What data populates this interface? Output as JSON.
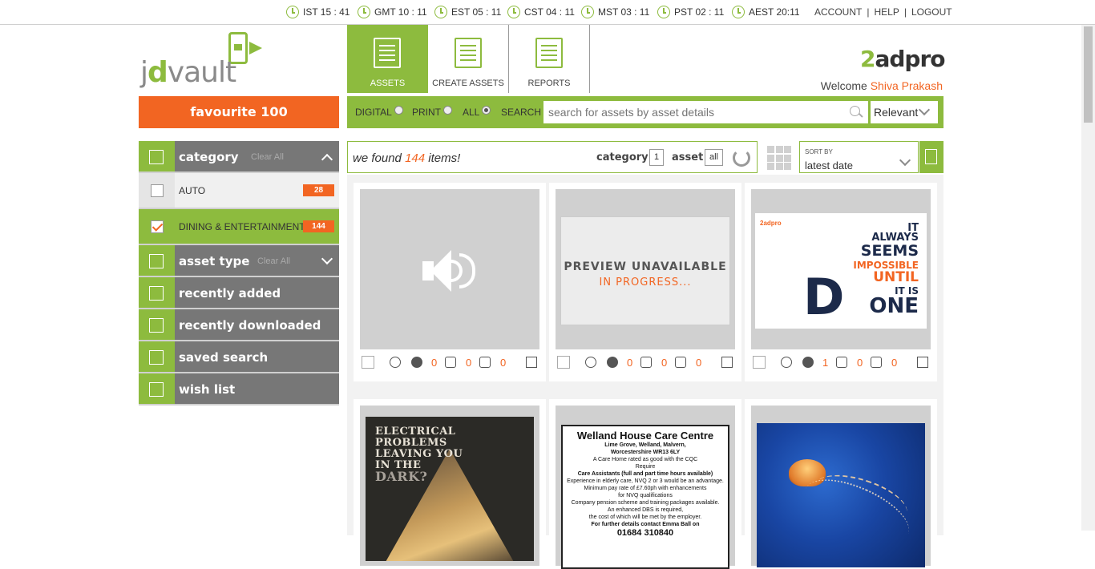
{
  "topbar": {
    "timezones": [
      {
        "label": "IST 15 : 41"
      },
      {
        "label": "GMT 10 : 11"
      },
      {
        "label": "EST 05 : 11"
      },
      {
        "label": "CST 04 : 11"
      },
      {
        "label": "MST 03 : 11"
      },
      {
        "label": "PST 02 : 11"
      },
      {
        "label": "AEST 20:11"
      }
    ],
    "links": {
      "account": "ACCOUNT",
      "help": "HELP",
      "logout": "LOGOUT",
      "sep": "|"
    }
  },
  "logo": {
    "prefix": "j",
    "bold": "d",
    "rest": "vault"
  },
  "favourite": "favourite 100",
  "nav_tabs": [
    {
      "label": "ASSETS",
      "icon": "document-list-icon",
      "active": true
    },
    {
      "label": "CREATE ASSETS",
      "icon": "edit-document-icon",
      "active": false
    },
    {
      "label": "REPORTS",
      "icon": "chart-board-icon",
      "active": false
    }
  ],
  "brand": {
    "num": "2",
    "rest": "adpro"
  },
  "welcome": {
    "prefix": "Welcome",
    "name": "Shiva Prakash"
  },
  "search": {
    "filters": [
      {
        "label": "DIGITAL",
        "checked": false
      },
      {
        "label": "PRINT",
        "checked": false
      },
      {
        "label": "ALL",
        "checked": true
      }
    ],
    "search_label": "SEARCH",
    "placeholder": "search for assets by asset details",
    "sort_select": "Relevant"
  },
  "sidebar": {
    "category": {
      "title": "category",
      "clear": "Clear All"
    },
    "items": [
      {
        "label": "AUTO",
        "count": "28",
        "checked": false
      },
      {
        "label": "DINING & ENTERTAINMENT",
        "count": "144",
        "checked": true
      }
    ],
    "asset_type": {
      "title": "asset type",
      "clear": "Clear All"
    },
    "links": [
      {
        "label": "recently added",
        "icon": "plus-square-icon"
      },
      {
        "label": "recently downloaded",
        "icon": "download-icon"
      },
      {
        "label": "saved search",
        "icon": "saved-search-icon"
      },
      {
        "label": "wish list",
        "icon": "wish-list-icon"
      }
    ]
  },
  "results": {
    "prefix": "we found",
    "count": "144",
    "suffix": "items!",
    "category_label": "category",
    "category_value": "1",
    "asset_label": "asset",
    "asset_value": "all"
  },
  "sort": {
    "label": "SORT BY",
    "value": "latest date"
  },
  "cards": [
    {
      "type": "audio",
      "likes": "0",
      "upvotes": "0",
      "downvotes": "0"
    },
    {
      "type": "preview",
      "t1": "PREVIEW UNAVAILABLE",
      "t2": "IN PROGRESS...",
      "likes": "0",
      "upvotes": "0",
      "downvotes": "0"
    },
    {
      "type": "quote",
      "brand": "2adpro",
      "lines": [
        "IT",
        "ALWAYS",
        "SEEMS",
        "IMPOSSIBLE",
        "UNTIL",
        "IT IS",
        "ONE"
      ],
      "big": "D",
      "likes": "1",
      "upvotes": "0",
      "downvotes": "0"
    },
    {
      "type": "poster",
      "lines": [
        "ELECTRICAL",
        "PROBLEMS",
        "LEAVING YOU",
        "IN THE",
        "DARK?"
      ]
    },
    {
      "type": "ad",
      "title": "Welland House Care Centre",
      "lines": [
        "Lime Grove, Welland, Malvern,",
        "Worcestershire WR13 6LY",
        "A Care Home rated as good with the CQC",
        "Require",
        "Care Assistants (full and part time hours available)",
        "Experience in elderly care, NVQ 2 or 3 would be an advantage.",
        "Minimum pay rate of £7.60ph with enhancements",
        "for NVQ qualifications",
        "Company pension scheme and training packages available.",
        "An enhanced DBS is required,",
        "the cost of which will be met by the employer.",
        "For further details contact Emma Ball on",
        "01684 310840"
      ]
    },
    {
      "type": "photo",
      "icon": "jellyfish-photo"
    }
  ],
  "colors": {
    "green": "#8dbb3e",
    "orange": "#f26522",
    "grey": "#777777"
  }
}
